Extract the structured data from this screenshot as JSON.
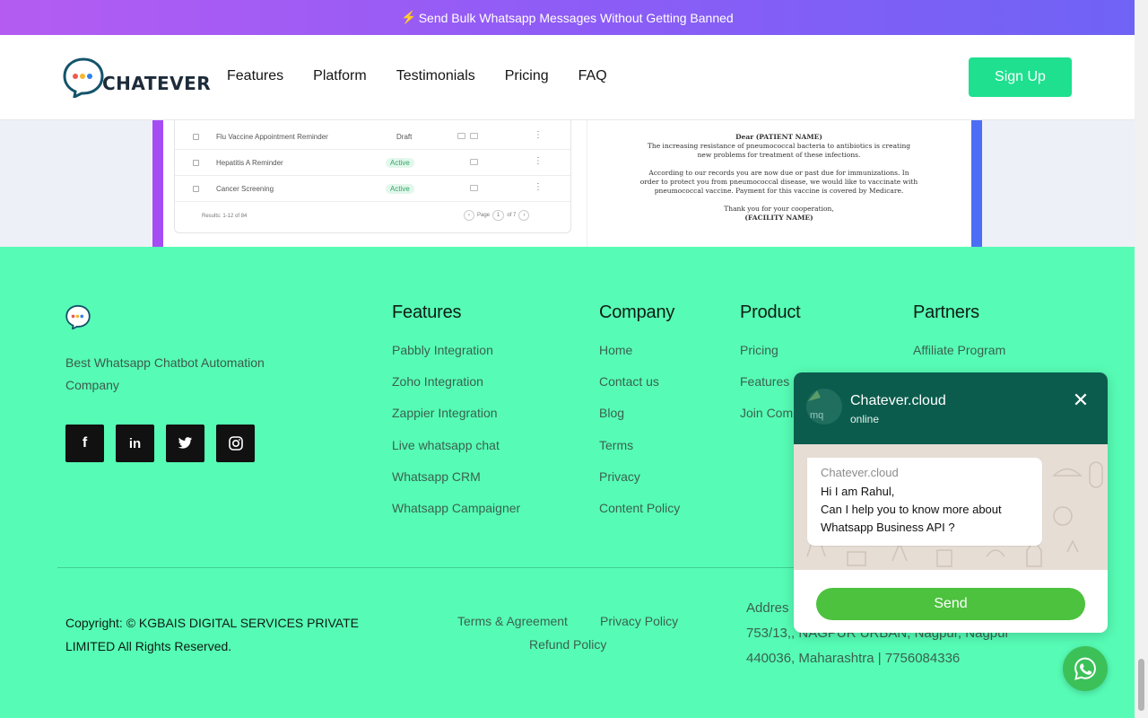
{
  "banner": {
    "bolt_icon": "⚡",
    "text": "Send Bulk Whatsapp Messages Without Getting Banned"
  },
  "header": {
    "logo_text": "CHATEVER",
    "nav": [
      "Features",
      "Platform",
      "Testimonials",
      "Pricing",
      "FAQ"
    ],
    "signup_label": "Sign Up"
  },
  "mock": {
    "rows": [
      {
        "name": "Flu Vaccine Appointment Reminder",
        "status": "Draft",
        "status_type": "draft"
      },
      {
        "name": "Hepatitis A Reminder",
        "status": "Active",
        "status_type": "active"
      },
      {
        "name": "Cancer Screening",
        "status": "Active",
        "status_type": "active"
      }
    ],
    "results": "Results: 1-12 of 84",
    "page_label": "Page",
    "page_num": "1",
    "page_of": "of 7",
    "letter": {
      "salutation": "Dear (PATIENT NAME)",
      "para1": "The increasing resistance of pneumococcal bacteria to antibiotics is creating new problems for treatment of these infections.",
      "para2": "According to our records you are now due or past due for immunizations. In order to protect you from pneumococcal disease, we would like to vaccinate with pneumococcal vaccine. Payment for this vaccine is covered by Medicare.",
      "closing": "Thank you for your cooperation,",
      "facility": "(FACILITY NAME)"
    }
  },
  "footer": {
    "tagline": "Best Whatsapp Chatbot Automation Company",
    "social": {
      "facebook": "f",
      "linkedin": "in",
      "twitter": "🐦",
      "instagram": "◎"
    },
    "features": {
      "title": "Features",
      "links": [
        "Pabbly Integration",
        "Zoho Integration",
        "Zappier Integration",
        "Live whatsapp chat",
        "Whatsapp CRM",
        "Whatsapp Campaigner"
      ]
    },
    "company": {
      "title": "Company",
      "links": [
        "Home",
        "Contact us",
        "Blog",
        "Terms",
        "Privacy",
        "Content Policy"
      ]
    },
    "product": {
      "title": "Product",
      "links": [
        "Pricing",
        "Features",
        "Join Com"
      ]
    },
    "partners": {
      "title": "Partners",
      "links": [
        "Affiliate Program"
      ]
    },
    "copyright": "Copyright: © KGBAIS DIGITAL SERVICES PRIVATE LIMITED All Rights Reserved.",
    "terms_agreement": "Terms & Agreement",
    "privacy_policy": "Privacy Policy",
    "refund_policy": "Refund Policy",
    "address_label": "Addres",
    "address_line1": "753/13,, NAGPUR URBAN, Nagpur, Nagpur",
    "address_line2": "440036, Maharashtra | 7756084336"
  },
  "chat": {
    "name": "Chatever.cloud",
    "status": "online",
    "avatar_alt": "mq",
    "bubble_from": "Chatever.cloud",
    "bubble_line1": "Hi I am Rahul,",
    "bubble_line2": "Can I help you to know more about",
    "bubble_line3": "Whatsapp Business API ?",
    "send_label": "Send"
  },
  "colors": {
    "footer_bg": "#56fcb5",
    "accent": "#1ee08f",
    "chat_header": "#0b5c4d",
    "send": "#4cc23e"
  }
}
